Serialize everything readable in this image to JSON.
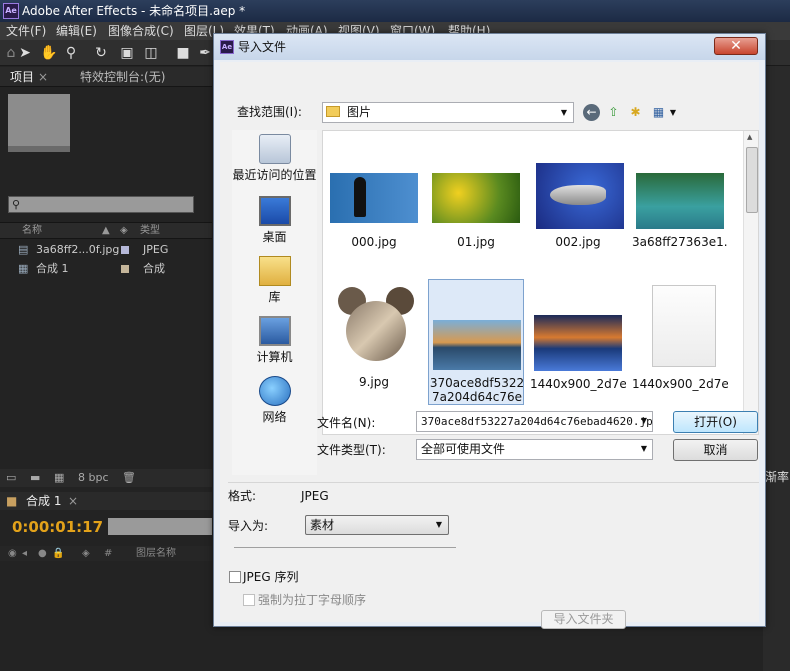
{
  "app": {
    "window_title": "Adobe After Effects - 未命名项目.aep *",
    "logo_text": "Ae",
    "menu": [
      "文件(F)",
      "编辑(E)",
      "图像合成(C)",
      "图层(L)",
      "效果(T)",
      "动画(A)",
      "视图(V)",
      "窗口(W)",
      "帮助(H)"
    ]
  },
  "project_panel": {
    "tab_project": "项目",
    "tab_effects": "特效控制台:(无)",
    "col_name": "名称",
    "col_type": "类型",
    "items": [
      {
        "name": "3a68ff2...0f.jpg",
        "type": "JPEG",
        "color": "#b5b8d8"
      },
      {
        "name": "合成 1",
        "type": "合成",
        "color": "#c4b59a"
      }
    ],
    "bpc": "8 bpc"
  },
  "timeline_panel": {
    "tab": "合成 1",
    "timecode": "0:00:01:17",
    "col_layer_name": "图层名称",
    "col_num": "#"
  },
  "dialog": {
    "title": "导入文件",
    "lookin_label": "查找范围(I):",
    "lookin_value": "图片",
    "places": [
      "最近访问的位置",
      "桌面",
      "库",
      "计算机",
      "网络"
    ],
    "files": [
      {
        "name": "000.jpg"
      },
      {
        "name": "01.jpg"
      },
      {
        "name": "002.jpg"
      },
      {
        "name": "3a68ff27363e1..."
      },
      {
        "name": "9.jpg"
      },
      {
        "name": "370ace8df53227a204d64c76ebad4620.jpg",
        "selected": true
      },
      {
        "name": "1440x900_2d7e..."
      },
      {
        "name": "1440x900_2d7e..."
      }
    ],
    "filename_label": "文件名(N):",
    "filename_value": "370ace8df53227a204d64c76ebad4620.jpg",
    "filetype_label": "文件类型(T):",
    "filetype_value": "全部可使用文件",
    "open_button": "打开(O)",
    "cancel_button": "取消",
    "format_label": "格式:",
    "format_value": "JPEG",
    "importas_label": "导入为:",
    "importas_value": "素材",
    "jpeg_sequence_label": "JPEG 序列",
    "force_alpha_label": "强制为拉丁字母顺序",
    "import_folder_button": "导入文件夹"
  },
  "right_panel_text": "渐率"
}
